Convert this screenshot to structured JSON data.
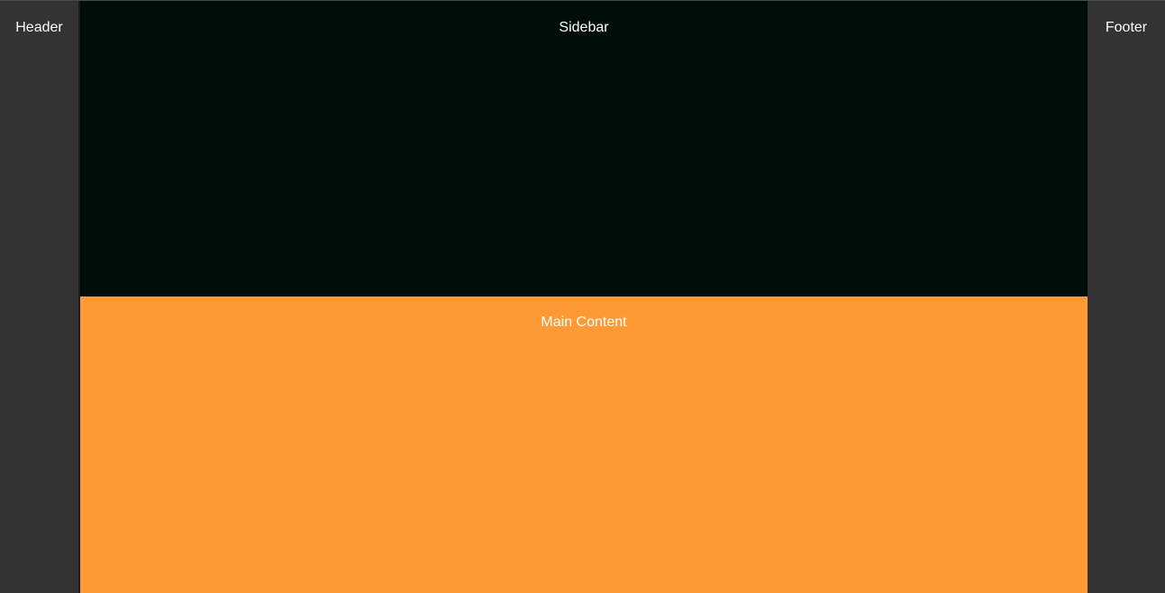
{
  "regions": {
    "header": {
      "label": "Header",
      "bg_color": "#333333"
    },
    "sidebar": {
      "label": "Sidebar",
      "bg_color": "#000d08"
    },
    "main": {
      "label": "Main Content",
      "bg_color": "#ff9933"
    },
    "footer": {
      "label": "Footer",
      "bg_color": "#333333"
    }
  }
}
